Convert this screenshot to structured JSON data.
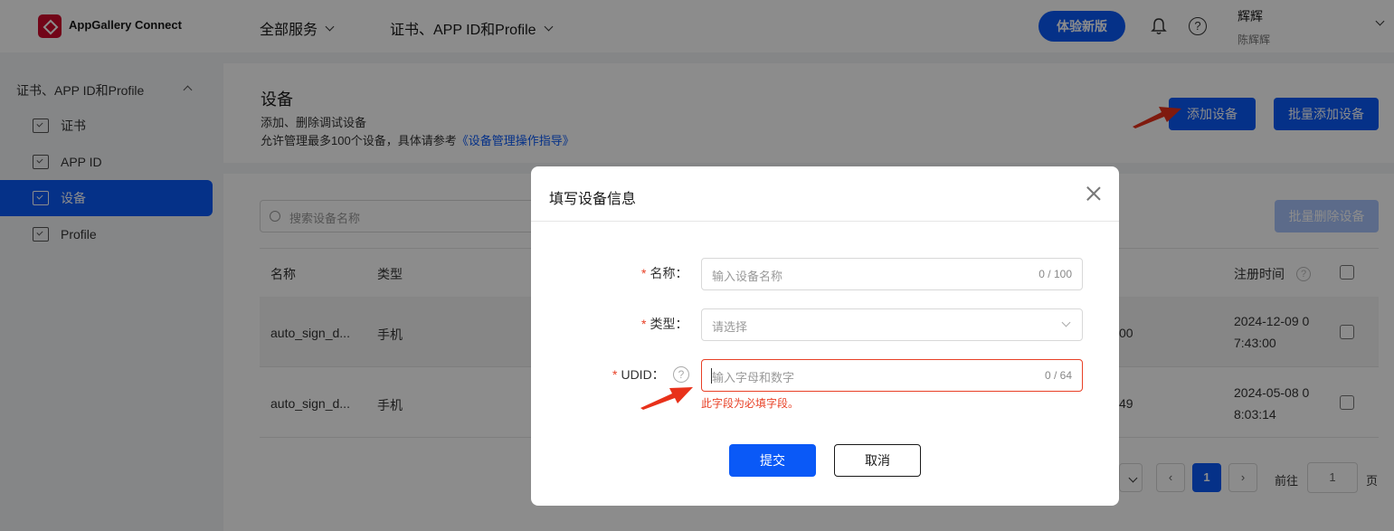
{
  "header": {
    "logo_text": "AppGallery Connect",
    "nav_all_services": "全部服务",
    "nav_certs": "证书、APP ID和Profile",
    "try_new_label": "体验新版",
    "user_name": "辉辉",
    "user_sub": "陈辉辉"
  },
  "sidebar": {
    "group_label": "证书、APP ID和Profile",
    "items": [
      {
        "label": "证书"
      },
      {
        "label": "APP ID"
      },
      {
        "label": "设备"
      },
      {
        "label": "Profile"
      }
    ]
  },
  "page": {
    "title": "设备",
    "desc1": "添加、删除调试设备",
    "desc2_prefix": "允许管理最多100个设备，具体请参考",
    "desc2_link": "《设备管理操作指导》",
    "add_device_label": "添加设备",
    "bulk_add_label": "批量添加设备"
  },
  "list": {
    "search_placeholder": "搜索设备名称",
    "bulk_delete_label": "批量删除设备",
    "columns": {
      "name": "名称",
      "type": "类型",
      "reg_time": "注册时间"
    },
    "rows": [
      {
        "name": "auto_sign_d...",
        "type": "手机",
        "udid_tail": "00",
        "reg_time_line1": "2024-12-09 0",
        "reg_time_line2": "7:43:00"
      },
      {
        "name": "auto_sign_d...",
        "type": "手机",
        "udid_tail": "49",
        "reg_time_line1": "2024-05-08 0",
        "reg_time_line2": "8:03:14"
      }
    ],
    "pager": {
      "current_page": "1",
      "goto_label": "前往",
      "goto_value": "1",
      "page_suffix": "页"
    }
  },
  "modal": {
    "title": "填写设备信息",
    "fields": {
      "name_label": "名称：",
      "name_placeholder": "输入设备名称",
      "name_count": "0 / 100",
      "type_label": "类型：",
      "type_placeholder": "请选择",
      "udid_label": "UDID：",
      "udid_placeholder": "输入字母和数字",
      "udid_count": "0 / 64",
      "udid_error": "此字段为必填字段。"
    },
    "submit_label": "提交",
    "cancel_label": "取消"
  },
  "colors": {
    "primary": "#0a59f7",
    "error": "#e84026",
    "annotation_arrow": "#e8311a"
  }
}
